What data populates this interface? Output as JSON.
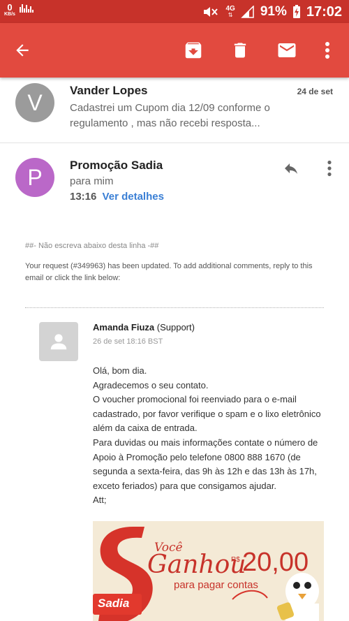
{
  "statusbar": {
    "speed_value": "0",
    "speed_unit": "KB/s",
    "network": "4G",
    "battery": "91%",
    "time": "17:02"
  },
  "appbar": {
    "icons": [
      "back-arrow-icon",
      "archive-icon",
      "trash-icon",
      "mail-icon",
      "more-vert-icon"
    ]
  },
  "thread": {
    "previous": {
      "avatar_letter": "V",
      "avatar_color": "#9b9b9b",
      "sender": "Vander Lopes",
      "date": "24 de set",
      "snippet": "Cadastrei um Cupom dia 12/09 conforme o regulamento , mas não recebi resposta..."
    },
    "current": {
      "avatar_letter": "P",
      "avatar_color": "#ba68c8",
      "sender": "Promoção Sadia",
      "recipient": "para mim",
      "time": "13:16",
      "details_link": "Ver detalhes"
    }
  },
  "email": {
    "note": "##- Não escreva abaixo desta linha -##",
    "request_text": "Your request (#349963) has been updated. To add additional comments, reply to this email or click the link below:",
    "agent_name": "Amanda Fiuza",
    "agent_role": "(Support)",
    "agent_date": "26 de set 18:16 BST",
    "message_lines": [
      "Olá, bom dia.",
      "Agradecemos o seu contato.",
      "O voucher promocional foi reenviado para o e-mail cadastrado, por favor verifique o spam e o lixo eletrônico além da caixa de entrada.",
      "Para duvidas ou mais informações contate o número de Apoio à Promoção pelo telefone 0800 888 1670 (de segunda a sexta-feira, das 9h às 12h e das 13h às 17h, exceto feriados) para que consigamos ajudar.",
      "Att;"
    ]
  },
  "banner": {
    "brand": "Sadia",
    "voce": "Você",
    "ganhou": "Ganhou",
    "currency": "R$",
    "amount": "20,00",
    "subtitle": "para pagar contas"
  }
}
